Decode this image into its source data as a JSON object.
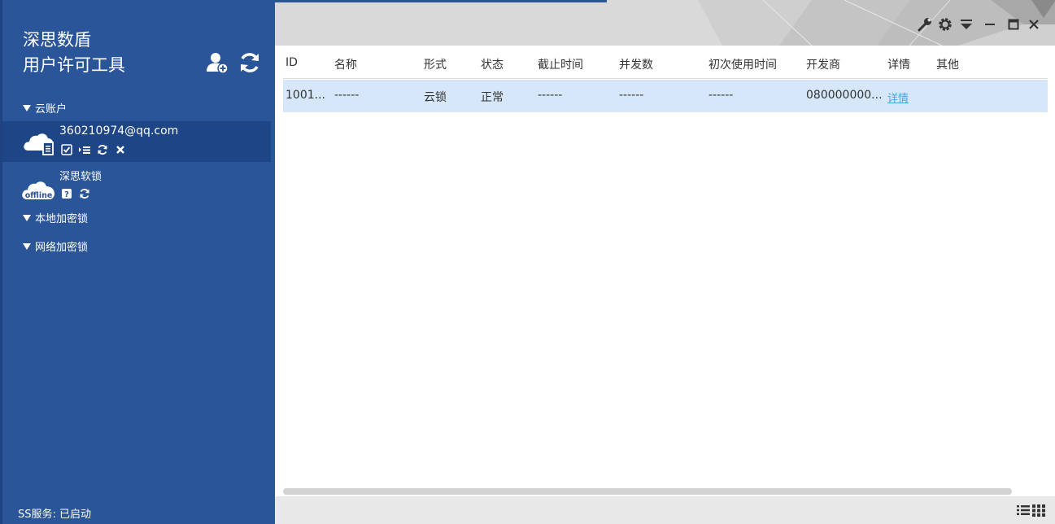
{
  "sidebar": {
    "title_line1": "深思数盾",
    "title_line2": "用户许可工具",
    "add_user_icon": "add-user-icon",
    "refresh_icon": "refresh-icon",
    "sections": {
      "cloud": "云账户",
      "local": "本地加密锁",
      "network": "网络加密锁"
    },
    "accounts": [
      {
        "name": "360210974@qq.com",
        "icon": "cloud-document-icon"
      },
      {
        "name": "深思软锁",
        "badge": "offline",
        "icon": "cloud-offline-icon"
      }
    ],
    "status": "SS服务: 已启动"
  },
  "table": {
    "columns": [
      "ID",
      "名称",
      "形式",
      "状态",
      "截止时间",
      "并发数",
      "初次使用时间",
      "开发商",
      "详情",
      "其他"
    ],
    "rows": [
      {
        "id": "1001...",
        "name": "------",
        "form": "云锁",
        "state": "正常",
        "deadline": "------",
        "concurrency": "------",
        "first_use": "------",
        "developer": "080000000...",
        "detail": "详情",
        "other": ""
      }
    ]
  },
  "colors": {
    "sidebar_bg": "#2a5599",
    "selected_bg": "#1e4586",
    "row_highlight": "#d5e7f9",
    "link": "#3fa9e0"
  }
}
